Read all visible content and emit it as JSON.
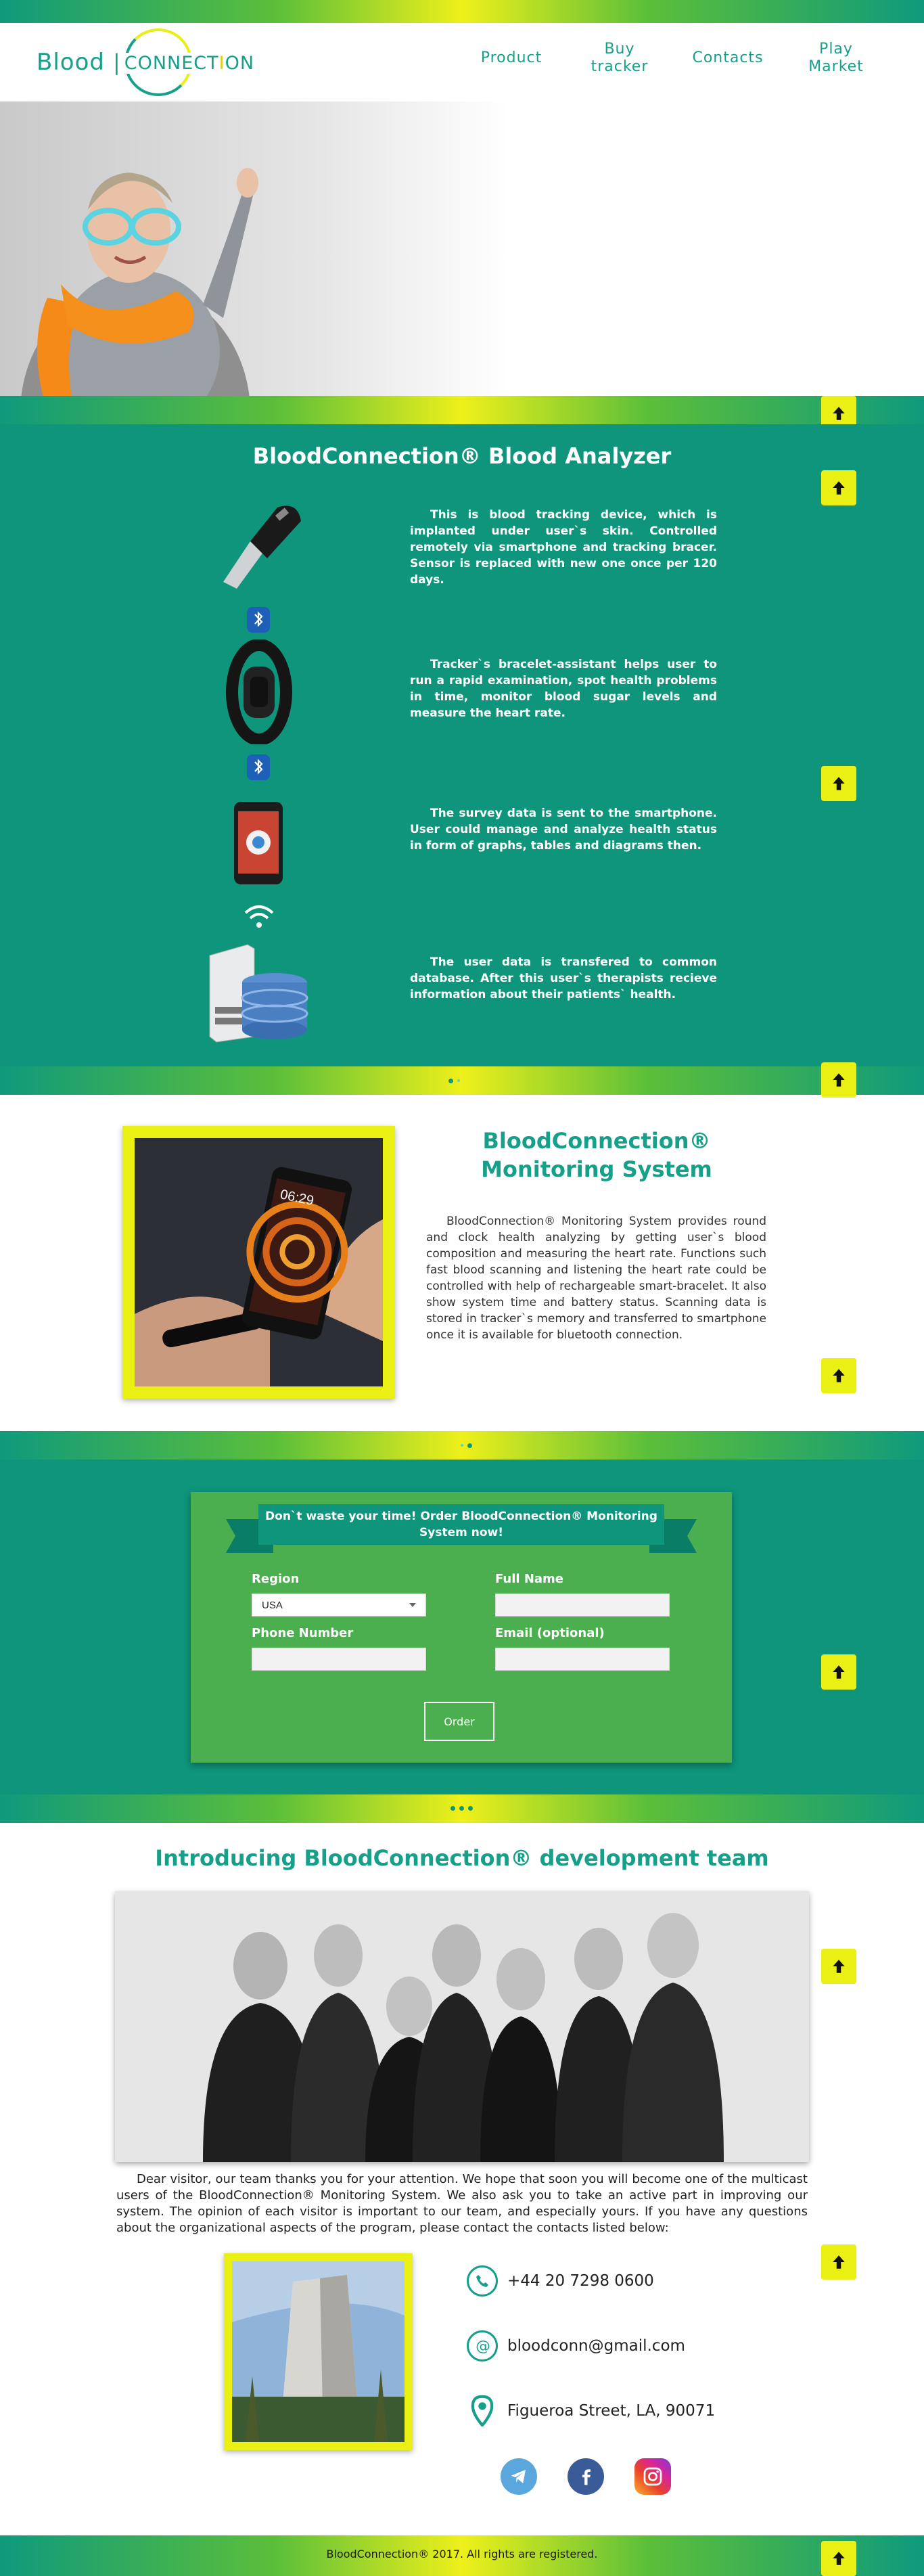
{
  "header": {
    "logo_left": "Blood",
    "logo_sep": "|",
    "logo_right_a": "CONNECT",
    "logo_right_b": "ON",
    "logo_right_mid": "I",
    "nav": [
      {
        "label": "Product"
      },
      {
        "label": "Buy tracker"
      },
      {
        "label": "Contacts"
      },
      {
        "label": "Play Market"
      }
    ]
  },
  "analyzer": {
    "title": "BloodConnection® Blood Analyzer",
    "items": [
      {
        "text": "This is blood tracking device, which is implanted under user`s skin. Controlled remotely via smartphone and tracking bracer. Sensor is replaced with new one once per 120 days.",
        "icon": "injector-device-icon"
      },
      {
        "text": "Tracker`s bracelet-assistant helps user to run a rapid examination, spot health problems in time, monitor blood sugar levels and measure the heart rate.",
        "icon": "fitness-bracelet-icon"
      },
      {
        "text": "The survey data is sent to the smartphone. User could manage and analyze health status in form of graphs, tables and diagrams then.",
        "icon": "smartphone-icon"
      },
      {
        "text": "The user data is transfered to common database. After this user`s therapists recieve information about their patients` health.",
        "icon": "server-database-icon"
      }
    ]
  },
  "monitoring": {
    "title": "BloodConnection® Monitoring System",
    "text": "BloodConnection® Monitoring System provides round and clock health analyzing by getting user`s blood composition and measuring the heart rate. Functions such fast blood scanning and listening the heart rate could be controlled with help of rechargeable smart-bracelet. It also show system time and battery status. Scanning data is stored in tracker`s memory and transferred to smartphone once it is available for bluetooth connection.",
    "phone_time": "06:29"
  },
  "order": {
    "title": "Don`t waste your time! Order BloodConnection® Monitoring System now!",
    "region_label": "Region",
    "region_value": "USA",
    "fullname_label": "Full Name",
    "fullname_value": "",
    "phone_label": "Phone Number",
    "phone_value": "",
    "email_label": "Email (optional)",
    "email_value": "",
    "button": "Order"
  },
  "team": {
    "title": "Introducing BloodConnection® development team",
    "thanks": "Dear visitor, our team thanks you for your attention. We hope that soon you will become one of the multicast users of the BloodConnection® Monitoring System. We also ask you to take an active part in improving our system. The opinion of each visitor is important to our team, and especially yours. If you have any questions about the organizational aspects of the program, please contact the contacts listed below:"
  },
  "contacts": {
    "phone": "+44 20 7298 0600",
    "email": "bloodconn@gmail.com",
    "address": "Figueroa Street, LA, 90071",
    "social": [
      {
        "icon": "telegram-icon",
        "color": "#5aa7de"
      },
      {
        "icon": "facebook-icon",
        "color": "#3b5b98"
      },
      {
        "icon": "instagram-icon",
        "color": "#d6249f"
      }
    ]
  },
  "footer": {
    "text": "BloodConnection® 2017. All rights are registered."
  },
  "colors": {
    "teal": "#0e957c",
    "accent_yellow": "#eaf013",
    "form_green": "#4bae4f"
  }
}
